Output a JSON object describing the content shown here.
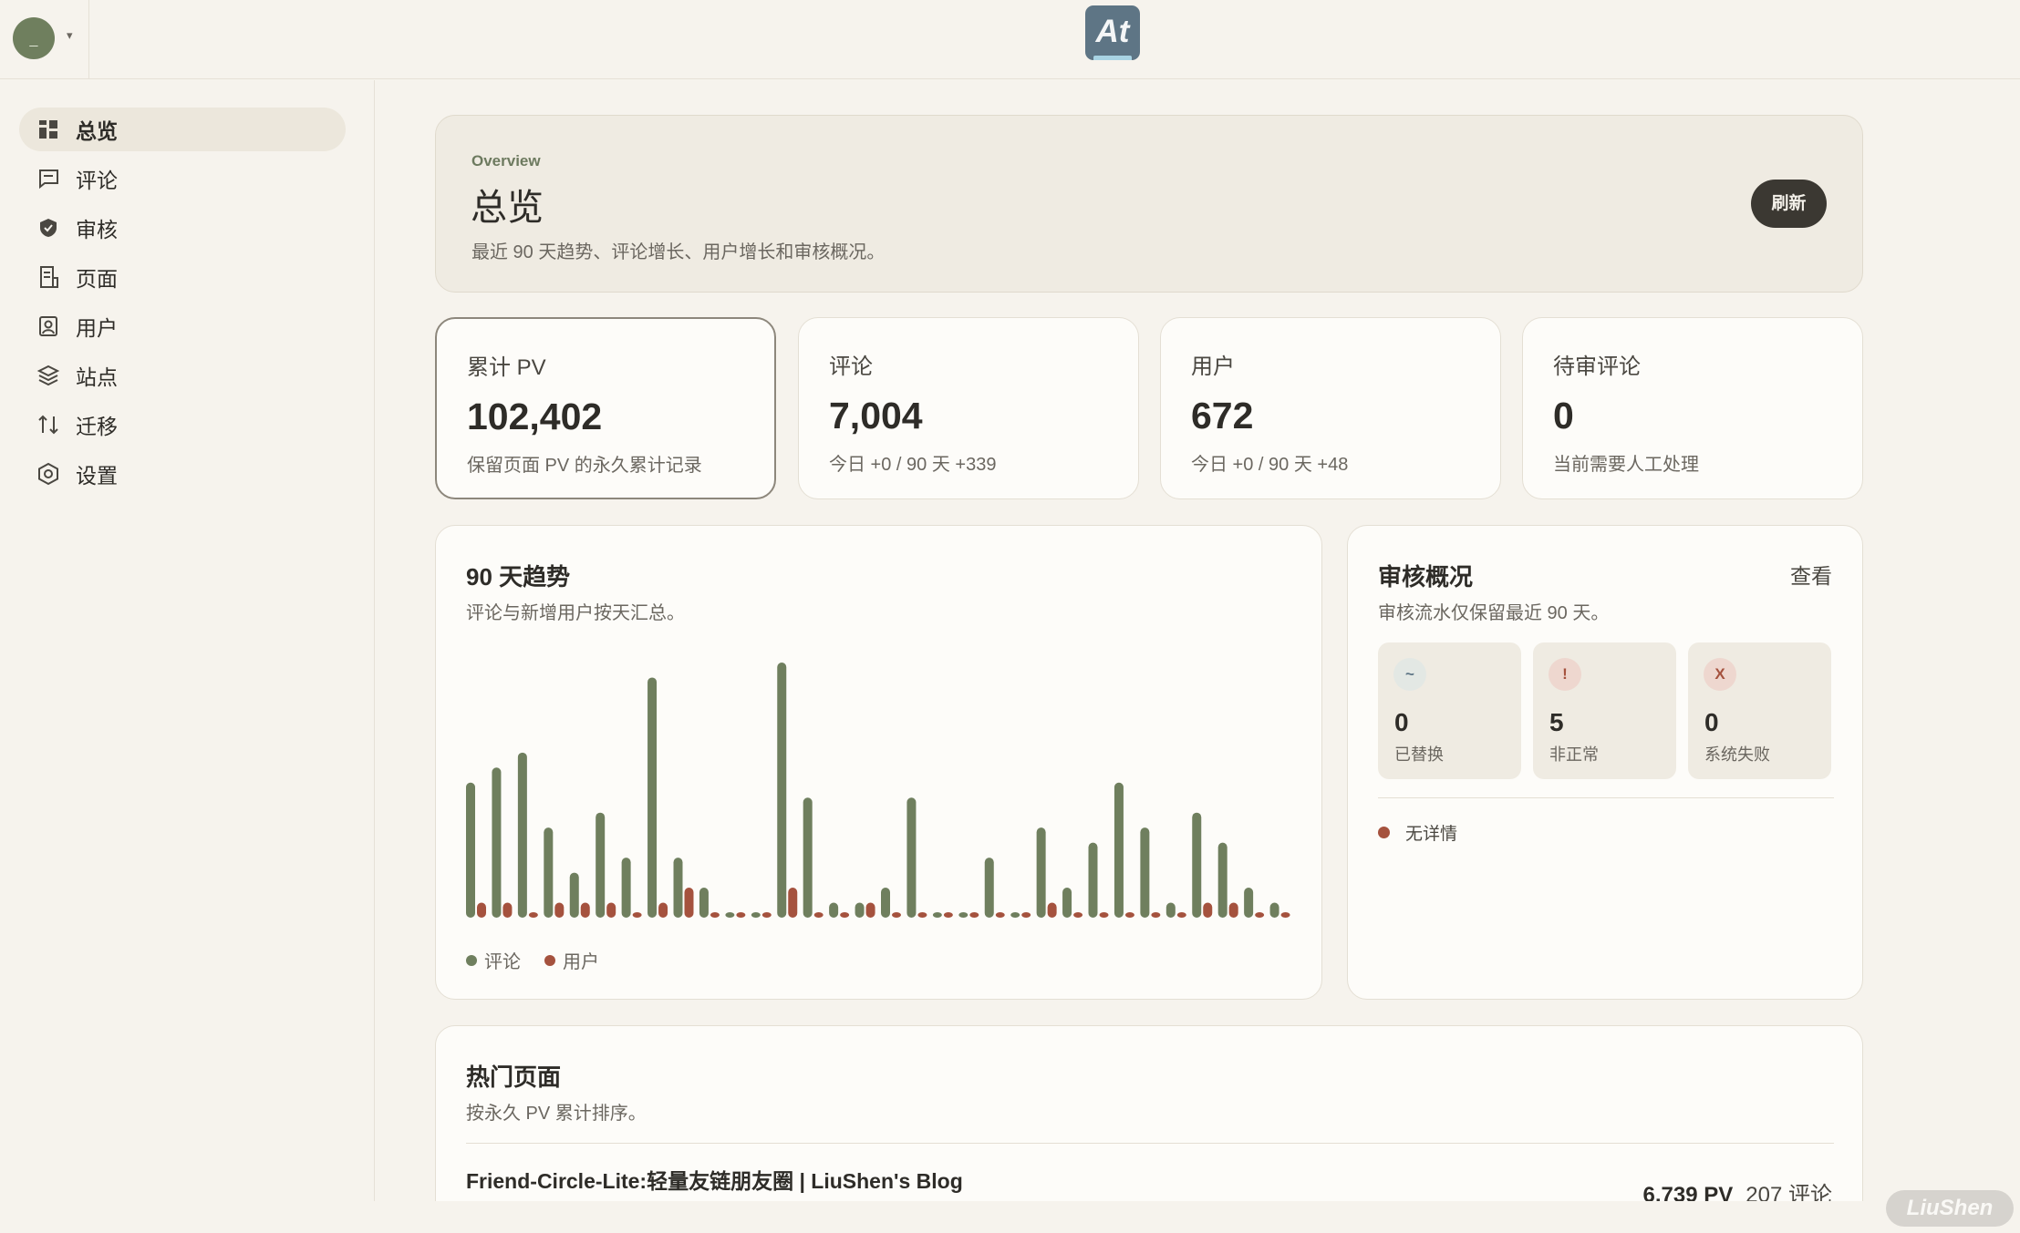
{
  "topbar": {
    "avatar_initial": "_",
    "caret": "▾",
    "logo_text": "At"
  },
  "sidebar": {
    "items": [
      {
        "label": "总览",
        "icon": "dashboard-icon",
        "active": true
      },
      {
        "label": "评论",
        "icon": "comment-icon",
        "active": false
      },
      {
        "label": "审核",
        "icon": "shield-check-icon",
        "active": false
      },
      {
        "label": "页面",
        "icon": "document-icon",
        "active": false
      },
      {
        "label": "用户",
        "icon": "user-card-icon",
        "active": false
      },
      {
        "label": "站点",
        "icon": "layers-icon",
        "active": false
      },
      {
        "label": "迁移",
        "icon": "migrate-icon",
        "active": false
      },
      {
        "label": "设置",
        "icon": "settings-hexagon-icon",
        "active": false
      }
    ]
  },
  "hero": {
    "eyebrow": "Overview",
    "title": "总览",
    "subtitle": "最近 90 天趋势、评论增长、用户增长和审核概况。",
    "refresh_label": "刷新"
  },
  "stats": [
    {
      "label": "累计 PV",
      "value": "102,402",
      "sub": "保留页面 PV 的永久累计记录"
    },
    {
      "label": "评论",
      "value": "7,004",
      "sub": "今日 +0 / 90 天 +339"
    },
    {
      "label": "用户",
      "value": "672",
      "sub": "今日 +0 / 90 天 +48"
    },
    {
      "label": "待审评论",
      "value": "0",
      "sub": "当前需要人工处理"
    }
  ],
  "trend": {
    "title": "90 天趋势",
    "subtitle": "评论与新增用户按天汇总。"
  },
  "chart_data": {
    "type": "bar",
    "series": [
      {
        "name": "评论",
        "color": "#6f7f5e",
        "values": [
          9,
          10,
          11,
          6,
          3,
          7,
          4,
          16,
          4,
          2,
          0,
          0,
          17,
          8,
          1,
          1,
          2,
          8,
          0,
          0,
          4,
          0,
          6,
          2,
          5,
          9,
          6,
          1,
          7,
          5,
          2,
          1
        ]
      },
      {
        "name": "用户",
        "color": "#a5523e",
        "values": [
          1,
          1,
          0,
          1,
          1,
          1,
          0,
          1,
          2,
          0,
          0,
          0,
          2,
          0,
          0,
          1,
          0,
          0,
          0,
          0,
          0,
          0,
          1,
          0,
          0,
          0,
          0,
          0,
          1,
          1,
          0,
          0
        ]
      }
    ],
    "grid": false,
    "legend": "bottom-left"
  },
  "review": {
    "title": "审核概况",
    "subtitle": "审核流水仅保留最近 90 天。",
    "view_label": "查看",
    "tiles": [
      {
        "icon_char": "~",
        "value": "0",
        "label": "已替换",
        "icon_bg": "#e3e8e4",
        "icon_fg": "#5e7585"
      },
      {
        "icon_char": "!",
        "value": "5",
        "label": "非正常",
        "icon_bg": "#eed7cf",
        "icon_fg": "#a5523e"
      },
      {
        "icon_char": "X",
        "value": "0",
        "label": "系统失败",
        "icon_bg": "#eed7cf",
        "icon_fg": "#a5523e"
      }
    ],
    "empty_text": "无详情"
  },
  "pages": {
    "title": "热门页面",
    "subtitle": "按永久 PV 累计排序。",
    "rows": [
      {
        "title": "Friend-Circle-Lite:轻量友链朋友圈 | LiuShen's Blog",
        "pv": "6,739 PV",
        "comments": "207 评论"
      }
    ]
  },
  "watermark": "LiuShen",
  "colors": {
    "accent_green": "#6f7f5e",
    "accent_red": "#a5523e",
    "dark_button": "#3b3832"
  }
}
